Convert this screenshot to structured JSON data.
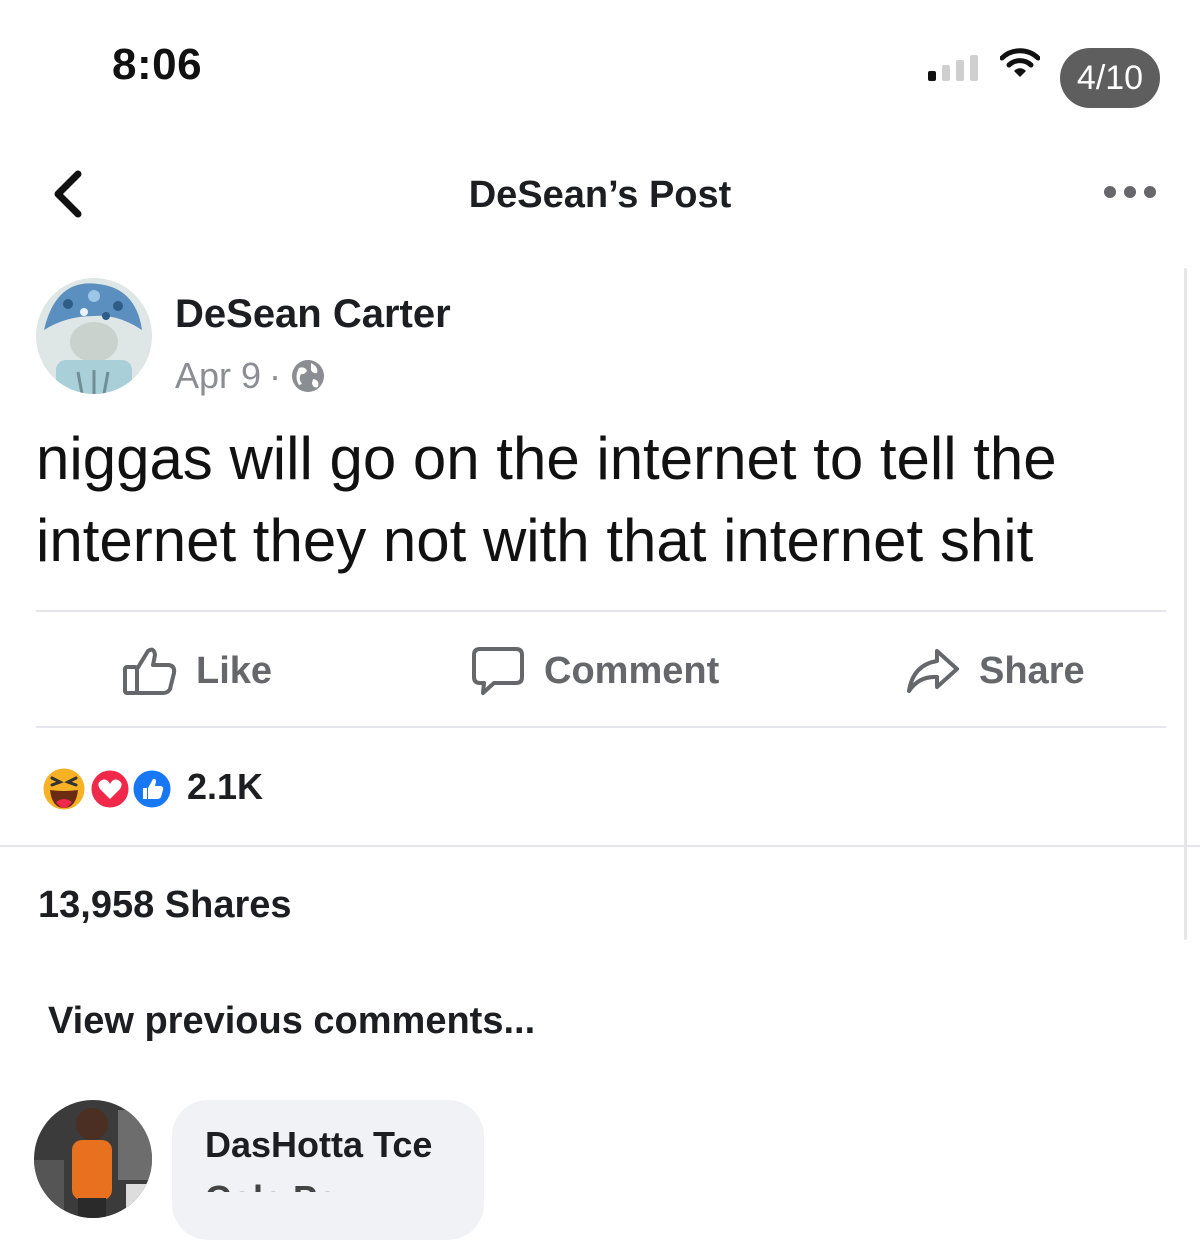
{
  "status_bar": {
    "time": "8:06",
    "battery_label": "4/10"
  },
  "header": {
    "title": "DeSean’s Post"
  },
  "post": {
    "author": "DeSean Carter",
    "date": "Apr 9",
    "separator": "·",
    "text": "niggas will go on the internet to tell the internet they not with that internet shit"
  },
  "actions": {
    "like": "Like",
    "comment": "Comment",
    "share": "Share"
  },
  "engagement": {
    "reaction_icons": [
      "haha-icon",
      "love-icon",
      "like-icon"
    ],
    "reaction_count": "2.1K",
    "shares": "13,958 Shares"
  },
  "comments": {
    "view_previous": "View previous comments...",
    "items": [
      {
        "name": "DasHotta Tce",
        "text": "Cole Pezzy"
      }
    ]
  },
  "colors": {
    "text": "#1c1e21",
    "muted": "#65676b",
    "like_blue": "#1877f2",
    "love_red": "#f0284a",
    "haha_yellow": "#f7b125"
  }
}
